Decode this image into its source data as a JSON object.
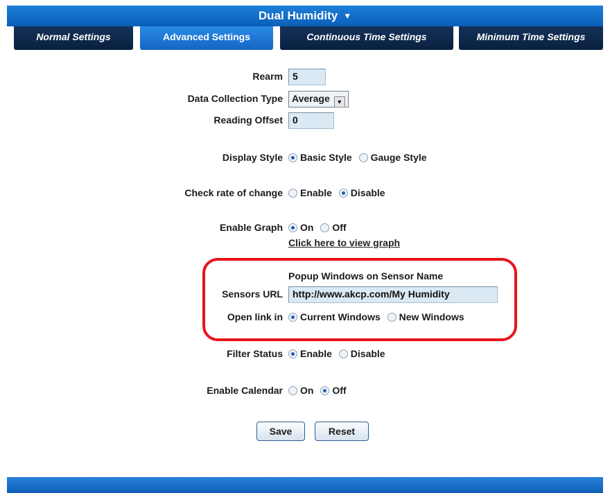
{
  "header": {
    "title": "Dual Humidity",
    "arrow": "▼"
  },
  "tabs": [
    {
      "label": "Normal Settings",
      "active": false
    },
    {
      "label": "Advanced Settings",
      "active": true
    },
    {
      "label": "Continuous Time Settings",
      "active": false
    },
    {
      "label": "Minimum Time Settings",
      "active": false
    }
  ],
  "form": {
    "rearm": {
      "label": "Rearm",
      "value": "5"
    },
    "data_collection": {
      "label": "Data Collection Type",
      "value": "Average"
    },
    "reading_offset": {
      "label": "Reading Offset",
      "value": "0"
    },
    "display_style": {
      "label": "Display Style",
      "opt1": "Basic Style",
      "opt2": "Gauge Style",
      "selected": "Basic Style"
    },
    "rate_of_change": {
      "label": "Check rate of change",
      "opt1": "Enable",
      "opt2": "Disable",
      "selected": "Disable"
    },
    "enable_graph": {
      "label": "Enable Graph",
      "opt1": "On",
      "opt2": "Off",
      "selected": "On",
      "link": "Click here to view graph"
    },
    "popup": {
      "title": "Popup Windows on Sensor Name",
      "url_label": "Sensors URL",
      "url_value": "http://www.akcp.com/My Humidity",
      "open_label": "Open link in",
      "opt1": "Current Windows",
      "opt2": "New Windows",
      "selected": "Current Windows"
    },
    "filter_status": {
      "label": "Filter Status",
      "opt1": "Enable",
      "opt2": "Disable",
      "selected": "Enable"
    },
    "enable_calendar": {
      "label": "Enable Calendar",
      "opt1": "On",
      "opt2": "Off",
      "selected": "Off"
    }
  },
  "buttons": {
    "save": "Save",
    "reset": "Reset"
  },
  "colors": {
    "header_blue": "#1466c2",
    "tab_dark": "#0e284d",
    "highlight": "#e8141b"
  }
}
